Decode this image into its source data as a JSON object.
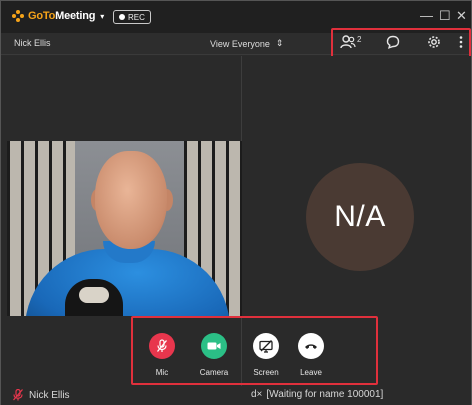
{
  "app": {
    "brand_prefix": "GoTo",
    "brand_suffix": "Meeting",
    "brand_caret": "▾"
  },
  "recording": {
    "label": "REC"
  },
  "window_controls": {
    "minimize": "—",
    "maximize": "☐",
    "close": "✕"
  },
  "toolbar": {
    "user_name": "Nick Ellis",
    "view_label": "View Everyone",
    "view_caret": "⇕",
    "attendee_count": "2",
    "icons": [
      "people-icon",
      "chat-icon",
      "settings-gear-icon",
      "more-vertical-icon"
    ]
  },
  "participant": {
    "placeholder_initials": "N/A"
  },
  "controls": {
    "mic_label": "Mic",
    "camera_label": "Camera",
    "screen_label": "Screen",
    "leave_label": "Leave",
    "colors": {
      "mic": "#e8364d",
      "camera": "#2bbf86",
      "screen": "#ffffff",
      "leave": "#ffffff"
    }
  },
  "bottombar": {
    "self_name": "Nick Ellis",
    "audio_prefix": "d×",
    "waiting_text": "[Waiting for name 100001]"
  },
  "colors": {
    "highlight": "#e0303c",
    "accent": "#f5a31a"
  }
}
